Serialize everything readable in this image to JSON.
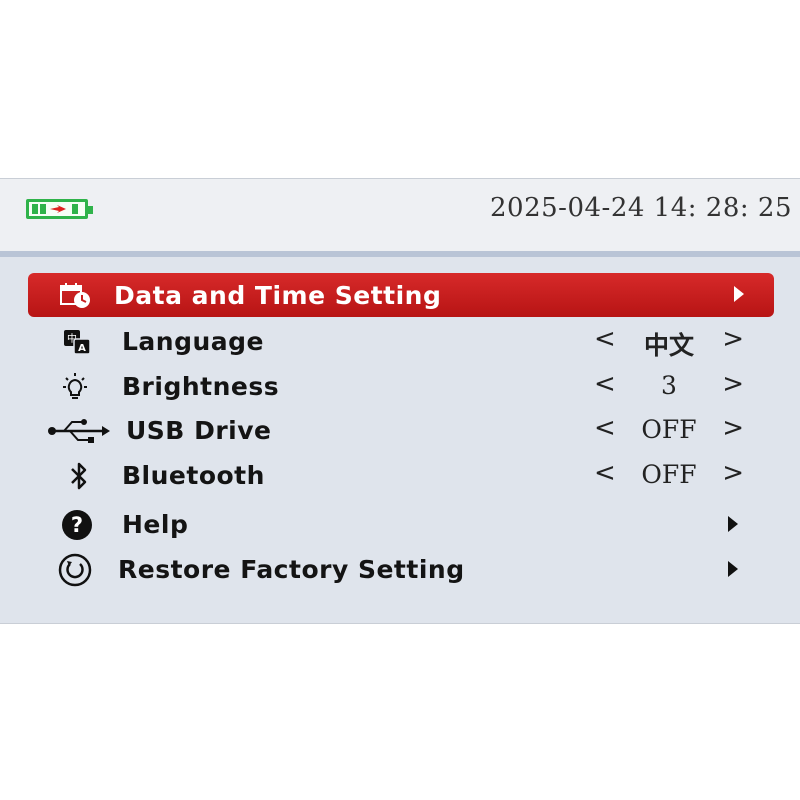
{
  "status_bar": {
    "battery_icon": "battery-charging-icon",
    "datetime": "2025-04-24 14: 28: 25"
  },
  "menu": {
    "items": [
      {
        "icon": "calendar-clock-icon",
        "label": "Data and Time Setting",
        "selected": true
      },
      {
        "icon": "language-icon",
        "label": "Language",
        "value": "中文"
      },
      {
        "icon": "brightness-icon",
        "label": "Brightness",
        "value": "3"
      },
      {
        "icon": "usb-icon",
        "label": "USB Drive",
        "value": "OFF"
      },
      {
        "icon": "bluetooth-icon",
        "label": "Bluetooth",
        "value": "OFF"
      },
      {
        "icon": "help-icon",
        "label": "Help"
      },
      {
        "icon": "restore-icon",
        "label": "Restore Factory Setting"
      }
    ]
  },
  "colors": {
    "selection": "#c81f1f",
    "battery": "#2fb34a",
    "background": "#dfe4ec"
  }
}
